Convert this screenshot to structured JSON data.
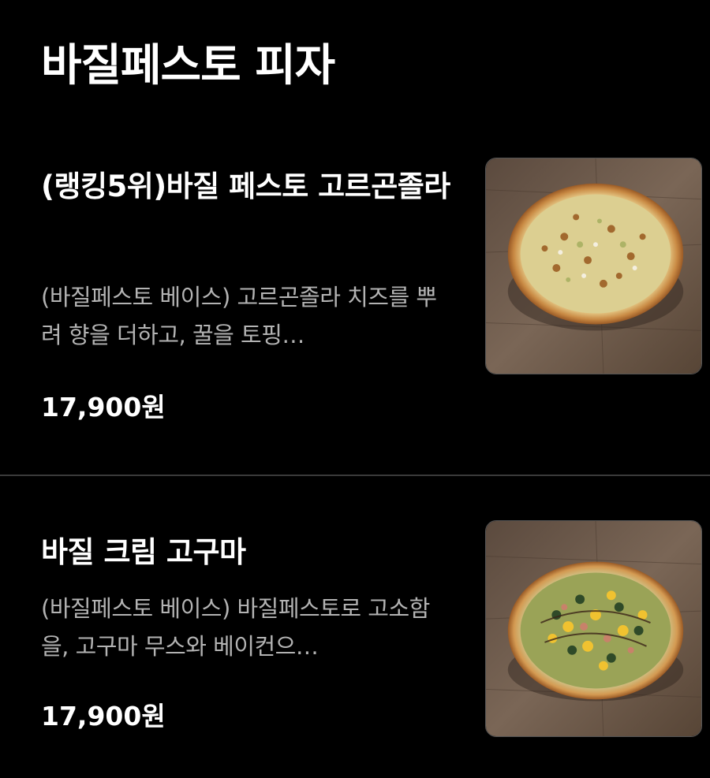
{
  "category": {
    "title": "바질페스토 피자"
  },
  "items": [
    {
      "name": "(랭킹5위)바질 페스토 고르곤졸라",
      "description": "(바질페스토 베이스) 고르곤졸라 치즈를 뿌려 향을 더하고, 꿀을 토핑…",
      "price": "17,900원",
      "image_alt": "gorgonzola basil pesto pizza"
    },
    {
      "name": "바질 크림 고구마",
      "description": "(바질페스토 베이스) 바질페스토로 고소함을, 고구마 무스와 베이컨으…",
      "price": "17,900원",
      "image_alt": "basil cream sweet potato pizza"
    }
  ],
  "colors": {
    "background": "#000000",
    "text_primary": "#ffffff",
    "text_secondary": "#b3b3b3",
    "divider": "#3a3a3a"
  }
}
